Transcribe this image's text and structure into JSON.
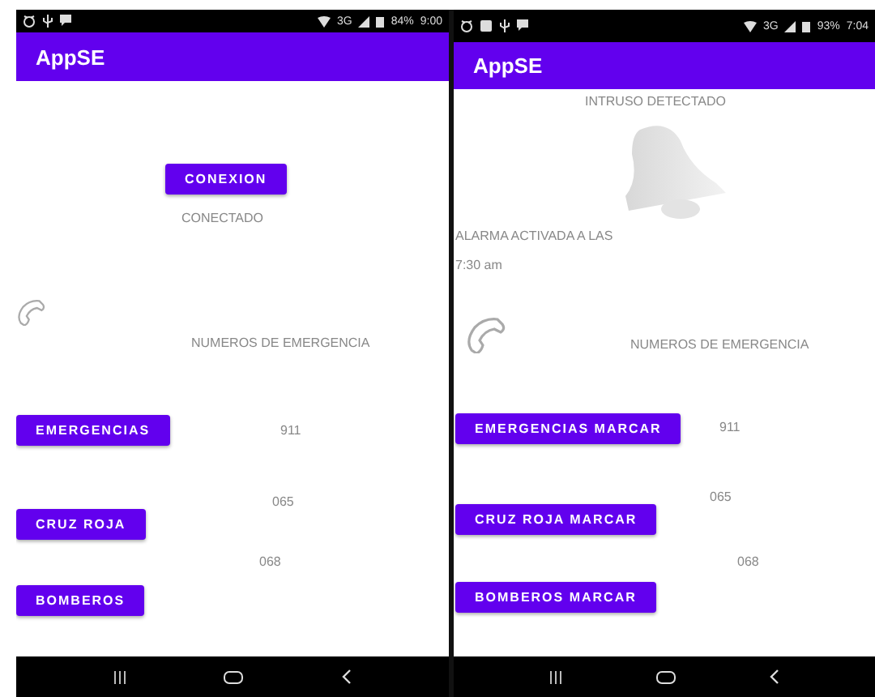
{
  "screens": [
    {
      "status_bar": {
        "network": "3G",
        "battery": "84%",
        "time": "9:00"
      },
      "app_bar": {
        "title": "AppSE"
      },
      "content": [
        {
          "kind": "button",
          "label": "CONEXION"
        },
        {
          "kind": "text",
          "text": "CONECTADO"
        },
        {
          "kind": "phone"
        },
        {
          "kind": "text",
          "text": "NUMEROS DE EMERGENCIA"
        },
        {
          "kind": "button",
          "label": "EMERGENCIAS"
        },
        {
          "kind": "text",
          "text": "911"
        },
        {
          "kind": "text",
          "text": "065"
        },
        {
          "kind": "button",
          "label": "CRUZ ROJA"
        },
        {
          "kind": "text",
          "text": "068"
        },
        {
          "kind": "button",
          "label": "BOMBEROS"
        }
      ]
    },
    {
      "status_bar": {
        "network": "3G",
        "battery": "93%",
        "time": "7:04"
      },
      "app_bar": {
        "title": "AppSE"
      },
      "content": [
        {
          "kind": "text",
          "text": "INTRUSO DETECTADO"
        },
        {
          "kind": "bell"
        },
        {
          "kind": "text",
          "text": "ALARMA ACTIVADA A LAS"
        },
        {
          "kind": "text",
          "text": "7:30 am"
        },
        {
          "kind": "phone"
        },
        {
          "kind": "text",
          "text": "NUMEROS DE EMERGENCIA"
        },
        {
          "kind": "button",
          "label": "EMERGENCIAS MARCAR"
        },
        {
          "kind": "text",
          "text": "911"
        },
        {
          "kind": "text",
          "text": "065"
        },
        {
          "kind": "button",
          "label": "CRUZ ROJA MARCAR"
        },
        {
          "kind": "text",
          "text": "068"
        },
        {
          "kind": "button",
          "label": "BOMBEROS MARCAR"
        }
      ]
    }
  ]
}
